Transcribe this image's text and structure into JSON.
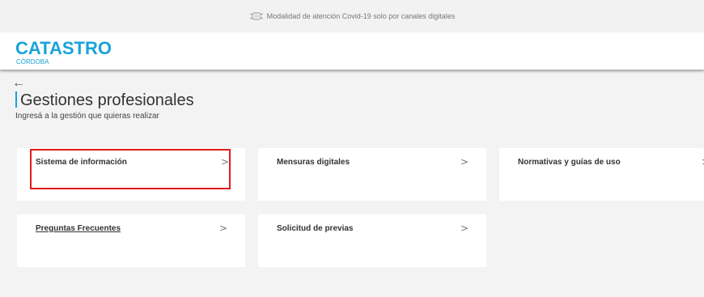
{
  "banner": {
    "text": "Modalidad de atención Covid-19 solo por canales digitales",
    "icon": "face-mask-icon"
  },
  "header": {
    "logo_main": "CATASTRO",
    "logo_sub": "CÓRDOBA",
    "brand_color": "#19a3da"
  },
  "page": {
    "back": "←",
    "title": "Gestiones profesionales",
    "subtitle": "Ingresá a la gestión que quieras realizar"
  },
  "cards": [
    {
      "label": "Sistema de información",
      "chevron": ">"
    },
    {
      "label": "Mensuras digitales",
      "chevron": ">"
    },
    {
      "label": "Normativas y guías de uso",
      "chevron": ">"
    },
    {
      "label": "Preguntas Frecuentes",
      "chevron": ">"
    },
    {
      "label": "Solicitud de previas",
      "chevron": ">"
    }
  ],
  "highlight_color": "#e01b1b"
}
